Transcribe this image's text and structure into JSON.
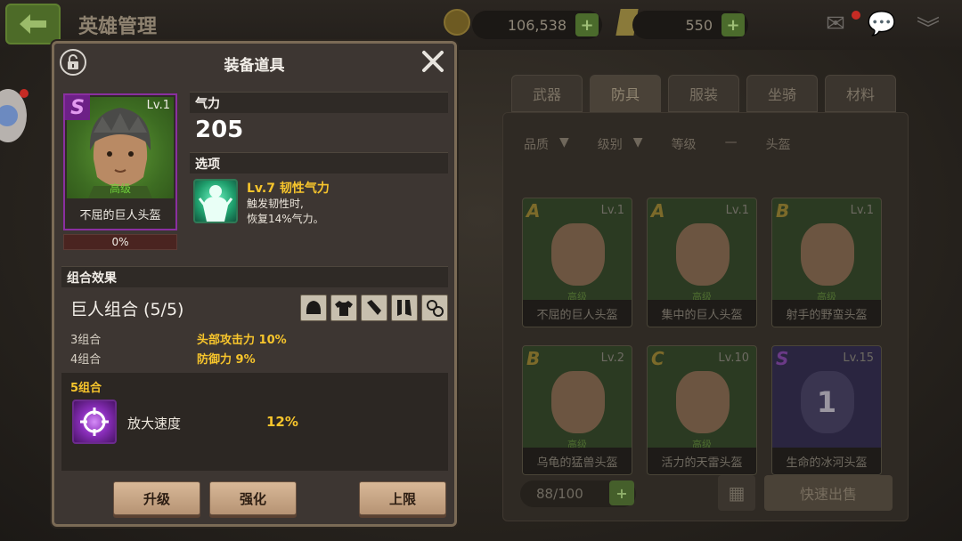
{
  "screen": {
    "title": "英雄管理",
    "coins": "106,538",
    "gems": "550",
    "tabs": [
      "武器",
      "防具",
      "服装",
      "坐骑",
      "材料"
    ],
    "active_tab": 1,
    "filters": [
      "品质",
      "级别",
      "等级",
      "—",
      "头盔"
    ],
    "inventory_count": "88/100",
    "sell_label": "快速出售",
    "items": [
      {
        "rank": "A",
        "lv": "Lv.1",
        "grade": "高级",
        "name": "不屈的巨人头盔"
      },
      {
        "rank": "A",
        "lv": "Lv.1",
        "grade": "高级",
        "name": "集中的巨人头盔"
      },
      {
        "rank": "B",
        "lv": "Lv.1",
        "grade": "高级",
        "name": "射手的野蛮头盔"
      },
      {
        "rank": "B",
        "lv": "Lv.2",
        "grade": "高级",
        "name": "乌龟的猛兽头盔"
      },
      {
        "rank": "C",
        "lv": "Lv.10",
        "grade": "高级",
        "name": "活力的天雷头盔"
      },
      {
        "rank": "S",
        "lv": "Lv.15",
        "grade": "1",
        "name": "生命的冰河头盔"
      }
    ]
  },
  "modal": {
    "title": "装备道具",
    "item": {
      "rank": "S",
      "level": "Lv.1",
      "grade": "高级",
      "name": "不屈的巨人头盔",
      "progress_label": "0%",
      "progress": 0
    },
    "stat_label": "气力",
    "stat_value": "205",
    "option_label": "选项",
    "skill": {
      "title": "Lv.7 韧性气力",
      "desc_line1": "触发韧性时,",
      "desc_line2": "恢复14%气力。"
    },
    "set_header": "组合效果",
    "set_title": "巨人组合 (5/5)",
    "set_rows": [
      {
        "label": "3组合",
        "bonus": "头部攻击力 10%"
      },
      {
        "label": "4组合",
        "bonus": "防御力 9%"
      }
    ],
    "set5": {
      "label": "5组合",
      "name": "放大速度",
      "value": "12%"
    },
    "buttons": {
      "upgrade": "升级",
      "enhance": "强化",
      "limit": "上限"
    }
  },
  "colors": {
    "accent_yellow": "#f7c52c",
    "rank_s_purple": "#8a2fa0",
    "grade_green": "#6fcf3a"
  }
}
